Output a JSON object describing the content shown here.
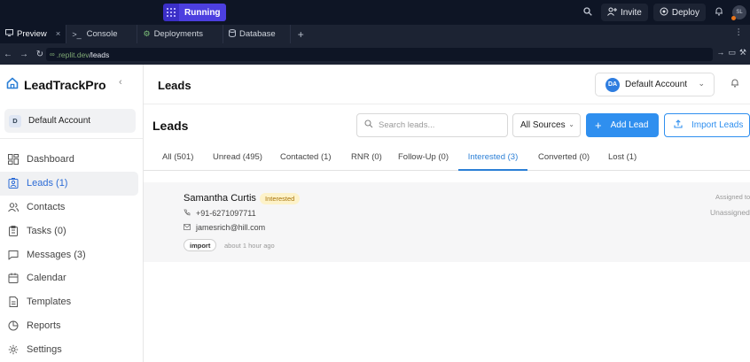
{
  "replit": {
    "run_label": "Running",
    "invite_label": "Invite",
    "deploy_label": "Deploy",
    "avatar_initials": "SL",
    "tabs": [
      {
        "label": "Preview",
        "icon": "monitor-icon",
        "active": true
      },
      {
        "label": "Console",
        "icon": "terminal-icon"
      },
      {
        "label": "Deployments",
        "icon": "deploy-icon"
      },
      {
        "label": "Database",
        "icon": "database-icon"
      }
    ],
    "url_host": ".replit.dev",
    "url_path": "/leads"
  },
  "sidebar": {
    "brand": "LeadTrackPro",
    "account_initial": "D",
    "account_name": "Default Account",
    "items": [
      {
        "label": "Dashboard",
        "icon": "dashboard-icon"
      },
      {
        "label": "Leads (1)",
        "icon": "leads-icon",
        "active": true
      },
      {
        "label": "Contacts",
        "icon": "contacts-icon"
      },
      {
        "label": "Tasks (0)",
        "icon": "tasks-icon"
      },
      {
        "label": "Messages (3)",
        "icon": "messages-icon"
      },
      {
        "label": "Calendar",
        "icon": "calendar-icon"
      },
      {
        "label": "Templates",
        "icon": "templates-icon"
      },
      {
        "label": "Reports",
        "icon": "reports-icon"
      },
      {
        "label": "Settings",
        "icon": "settings-icon"
      }
    ]
  },
  "header": {
    "title": "Leads",
    "account_initials": "DA",
    "account_name": "Default Account"
  },
  "leads_page": {
    "title": "Leads",
    "search_placeholder": "Search leads...",
    "source_filter": "All Sources",
    "add_label": "Add Lead",
    "import_label": "Import Leads",
    "tabs": [
      {
        "label": "All (501)"
      },
      {
        "label": "Unread (495)"
      },
      {
        "label": "Contacted (1)"
      },
      {
        "label": "RNR (0)"
      },
      {
        "label": "Follow-Up (0)"
      },
      {
        "label": "Interested (3)",
        "active": true
      },
      {
        "label": "Converted (0)"
      },
      {
        "label": "Lost (1)"
      }
    ]
  },
  "lead": {
    "name": "Samantha Curtis",
    "status": "Interested",
    "phone": "+91-6271097711",
    "email": "jamesrich@hill.com",
    "tag": "import",
    "time": "about 1 hour ago",
    "assigned_label": "Assigned to",
    "assigned_value": "Unassigned"
  },
  "colors": {
    "primary": "#2f8fef",
    "run": "#4c3fe0",
    "badge_bg": "#fdf2c9",
    "badge_text": "#a8740a"
  }
}
